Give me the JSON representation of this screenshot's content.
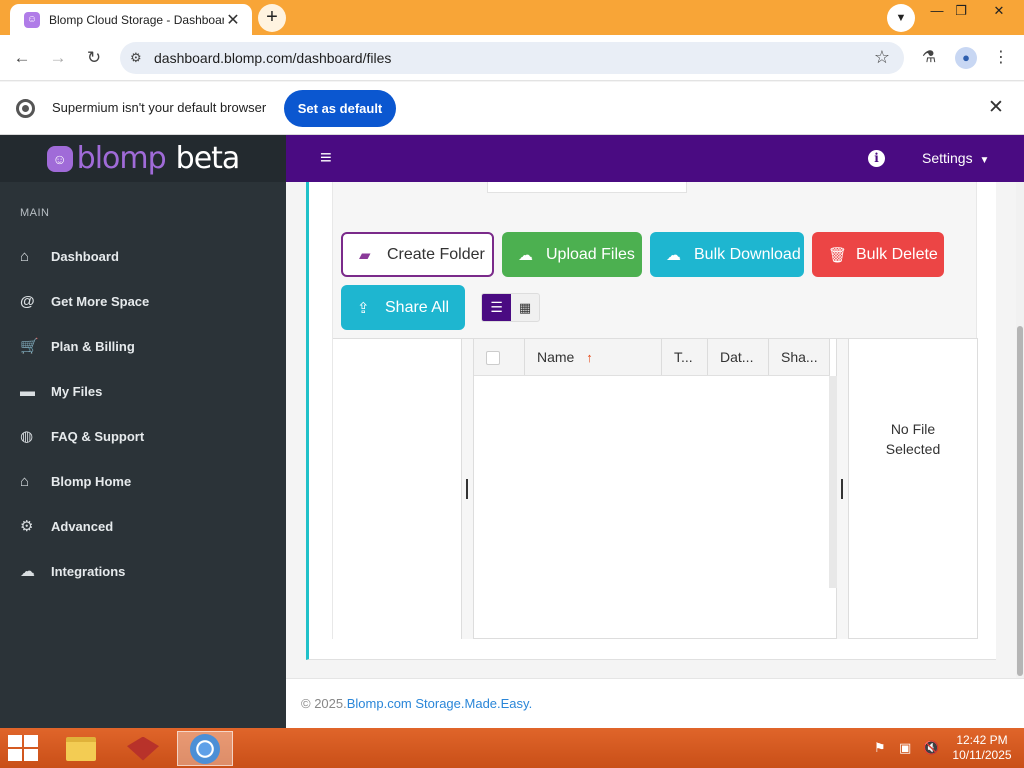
{
  "browser": {
    "tab_title": "Blomp Cloud Storage - Dashboard",
    "tab_favicon": "blomp-favicon",
    "url": "dashboard.blomp.com/dashboard/files",
    "infobar_text": "Supermium isn't your default browser",
    "set_default_label": "Set as default"
  },
  "app": {
    "brand_name": "blomp",
    "brand_suffix": "beta",
    "brand_color": "#a06bd8",
    "topbar_color": "#4a0b82",
    "settings_label": "Settings"
  },
  "sidebar": {
    "section_label": "MAIN",
    "items": [
      {
        "label": "Dashboard",
        "icon": "home-icon"
      },
      {
        "label": "Get More Space",
        "icon": "at-icon"
      },
      {
        "label": "Plan & Billing",
        "icon": "cart-icon"
      },
      {
        "label": "My Files",
        "icon": "folder-icon"
      },
      {
        "label": "FAQ & Support",
        "icon": "globe-icon"
      },
      {
        "label": "Blomp Home",
        "icon": "house-icon"
      },
      {
        "label": "Advanced",
        "icon": "user-gear-icon"
      },
      {
        "label": "Integrations",
        "icon": "cloud-icon"
      }
    ]
  },
  "actions": {
    "create_folder": "Create Folder",
    "upload_files": "Upload Files",
    "bulk_download": "Bulk Download",
    "bulk_delete": "Bulk Delete",
    "share_all": "Share All"
  },
  "file_list": {
    "columns": [
      "Name",
      "T...",
      "Dat...",
      "Sha..."
    ],
    "sorted_by": "Name",
    "sort_direction": "ascending",
    "rows": []
  },
  "preview": {
    "empty_text_line1": "No File",
    "empty_text_line2": "Selected"
  },
  "footer": {
    "copyright": "© 2025.",
    "link_text": "Blomp.com Storage.Made.Easy."
  },
  "taskbar": {
    "time": "12:42 PM",
    "date": "10/11/2025"
  }
}
